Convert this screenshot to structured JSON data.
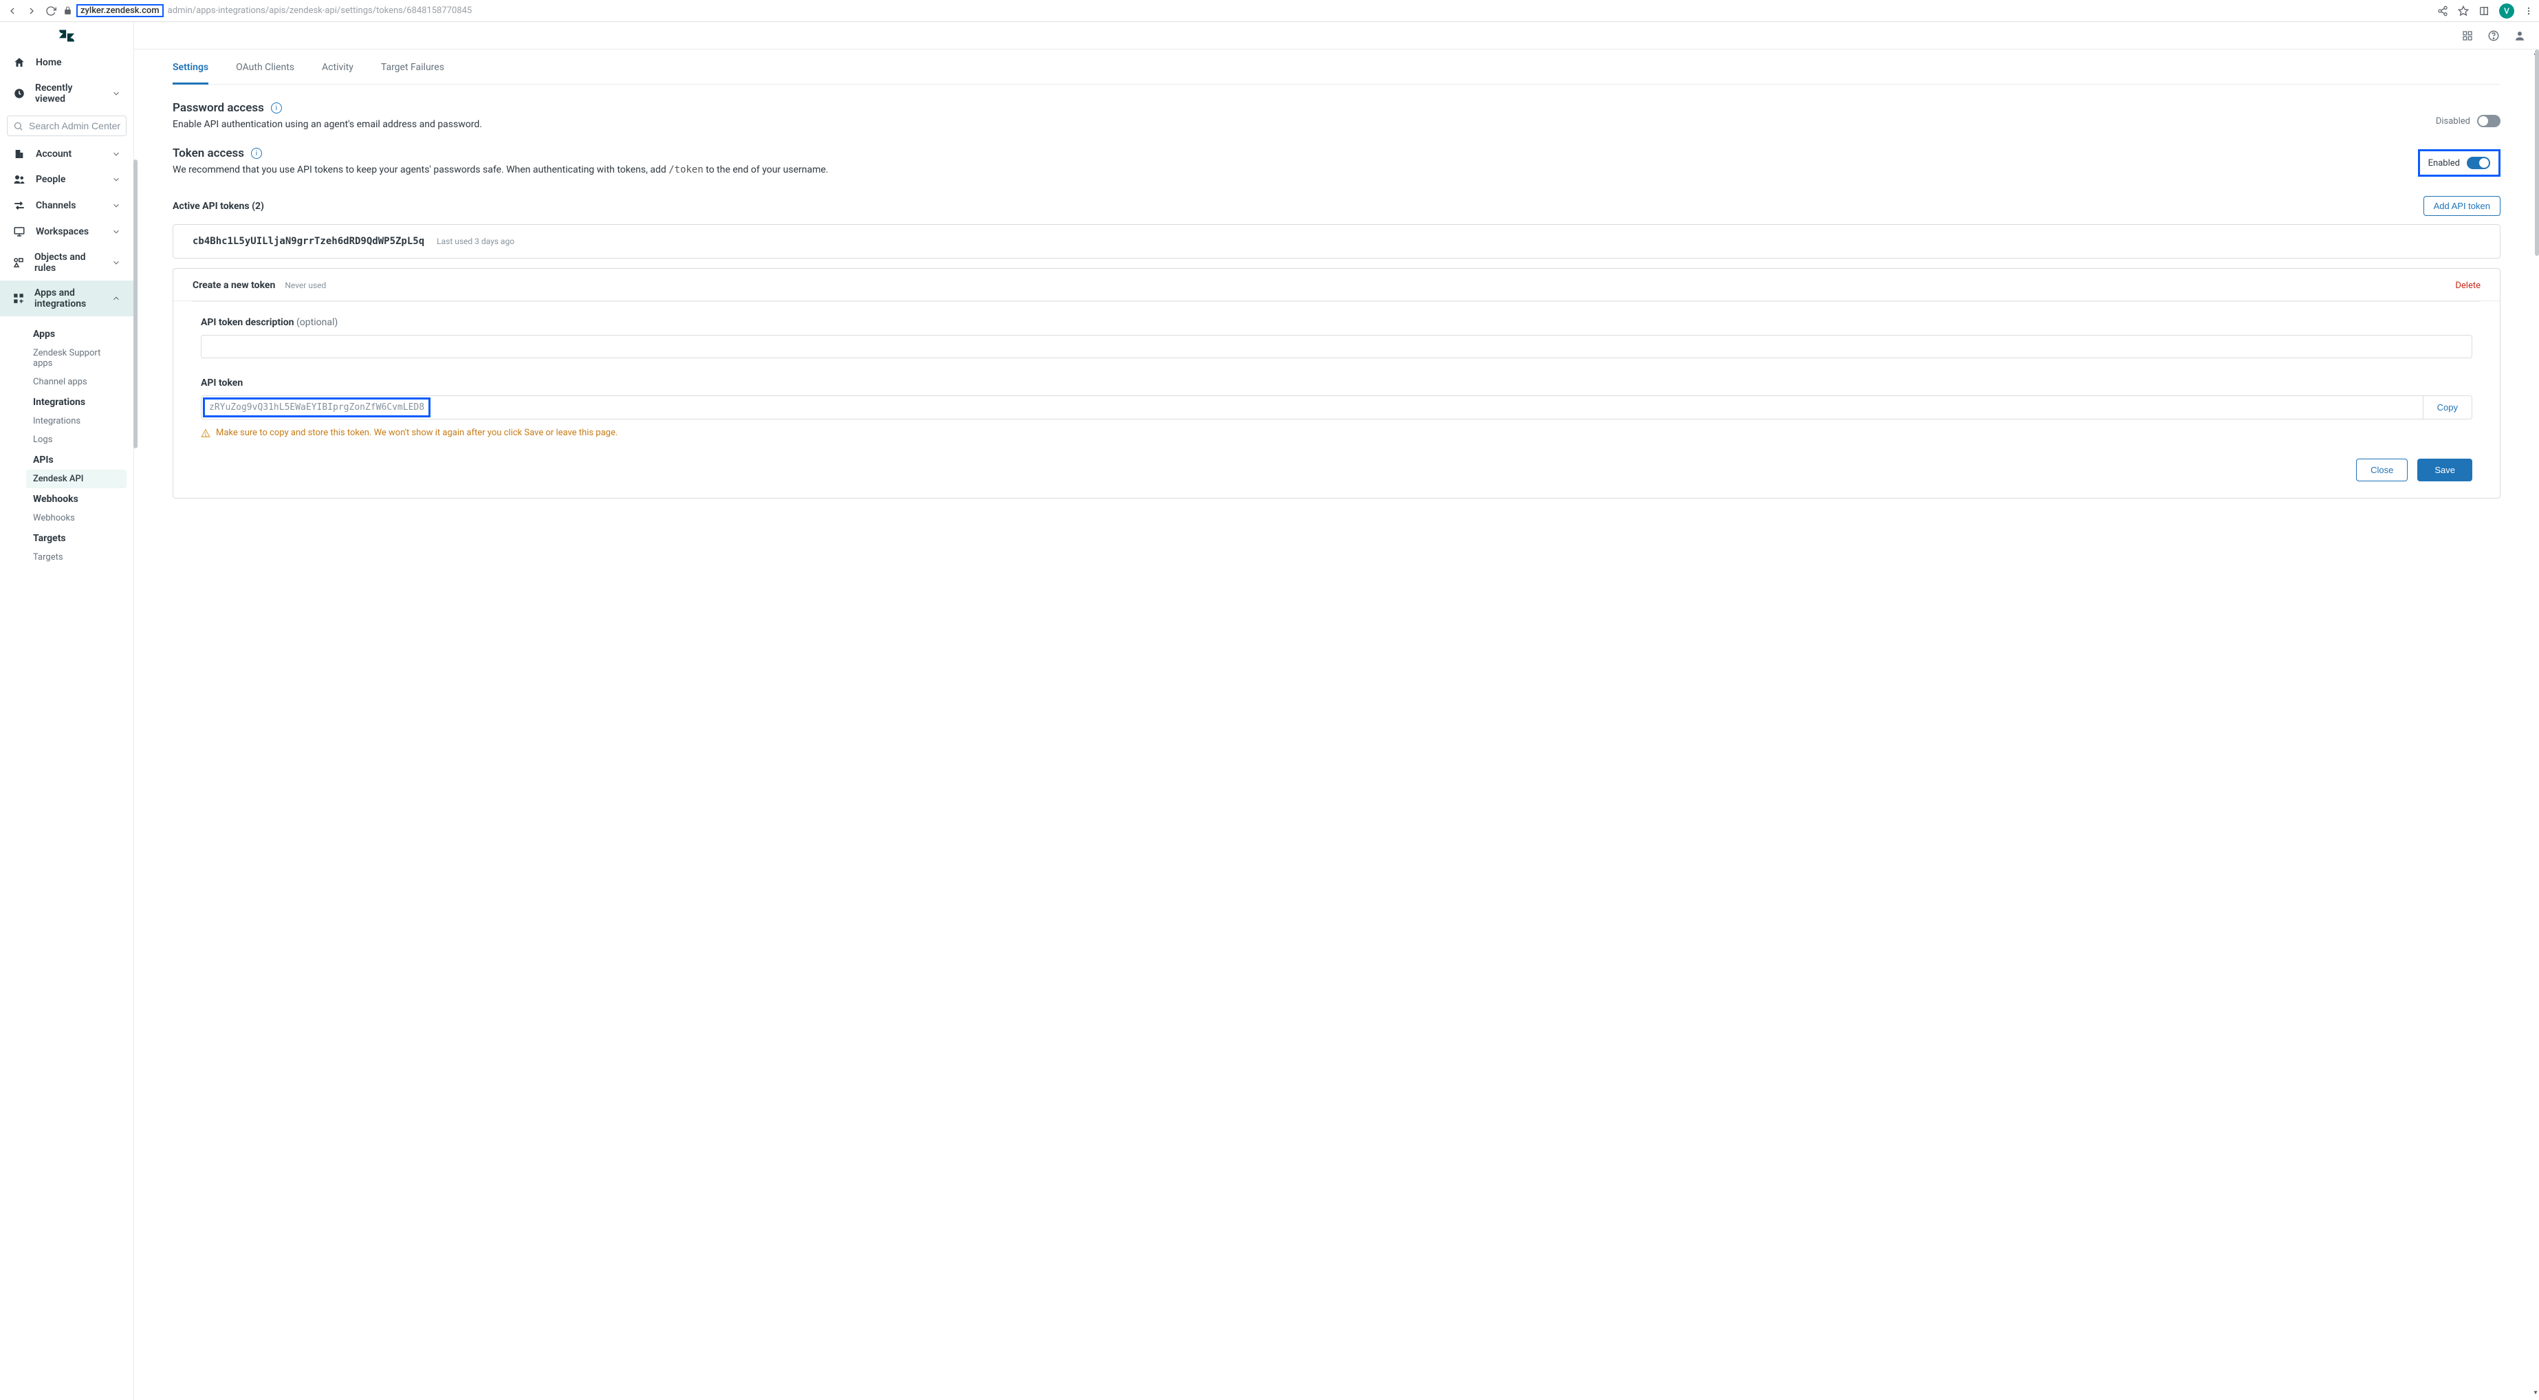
{
  "browser": {
    "domain": "zylker.zendesk.com",
    "path_rest": "admin/apps-integrations/apis/zendesk-api/settings/tokens/6848158770845",
    "avatar_letter": "V"
  },
  "sidebar": {
    "search_placeholder": "Search Admin Center",
    "home": "Home",
    "recently_viewed": "Recently viewed",
    "account": "Account",
    "people": "People",
    "channels": "Channels",
    "workspaces": "Workspaces",
    "objects": "Objects and rules",
    "apps_integrations": "Apps and integrations",
    "groups": {
      "apps": {
        "heading": "Apps",
        "sub1": "Zendesk Support apps",
        "sub2": "Channel apps"
      },
      "integrations": {
        "heading": "Integrations",
        "sub1": "Integrations",
        "sub2": "Logs"
      },
      "apis": {
        "heading": "APIs",
        "sub1": "Zendesk API"
      },
      "webhooks": {
        "heading": "Webhooks",
        "sub1": "Webhooks"
      },
      "targets": {
        "heading": "Targets",
        "sub1": "Targets"
      }
    }
  },
  "tabs": {
    "settings": "Settings",
    "oauth": "OAuth Clients",
    "activity": "Activity",
    "target_failures": "Target Failures"
  },
  "password_section": {
    "title": "Password access",
    "desc": "Enable API authentication using an agent's email address and password.",
    "toggle_label": "Disabled"
  },
  "token_section": {
    "title": "Token access",
    "desc_a": "We recommend that you use API tokens to keep your agents' passwords safe. When authenticating with tokens, add ",
    "desc_code": "/token",
    "desc_b": " to the end of your username.",
    "toggle_label": "Enabled"
  },
  "tokens": {
    "active_title": "Active API tokens (2)",
    "add_button": "Add API token",
    "existing": {
      "value": "cb4Bhc1L5yUILljaN9grrTzeh6dRD9QdWP5ZpL5q",
      "last_used": "Last used 3 days ago"
    },
    "create": {
      "title": "Create a new token",
      "never_used": "Never used",
      "delete": "Delete",
      "desc_label": "API token description ",
      "desc_optional": "(optional)",
      "token_label": "API token",
      "token_value": "zRYuZog9vQ31hL5EWaEYIBIprgZonZfW6CvmLED8",
      "copy": "Copy",
      "warning": "Make sure to copy and store this token. We won't show it again after you click Save or leave this page.",
      "close": "Close",
      "save": "Save"
    }
  }
}
